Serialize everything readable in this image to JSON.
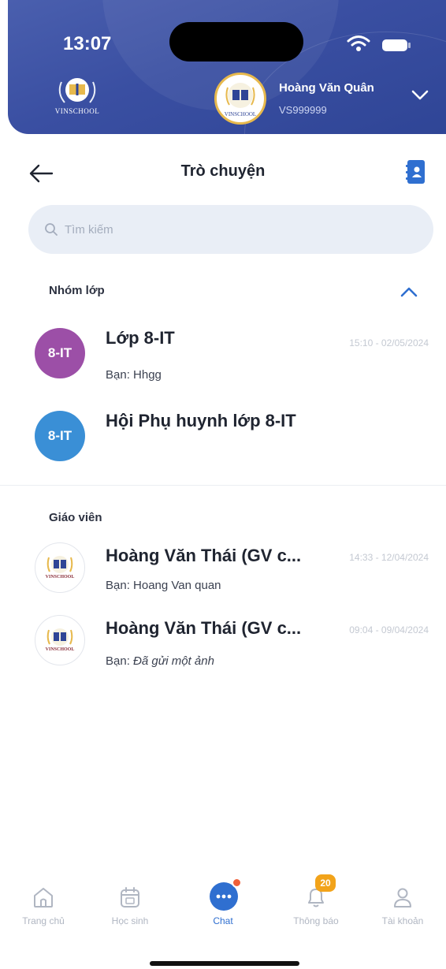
{
  "status_bar": {
    "time": "13:07"
  },
  "header": {
    "school_logo_text": "VINSCHOOL",
    "avatar_school_text": "VINSCHOOL",
    "user_name": "Hoàng Văn Quân",
    "user_code": "VS999999"
  },
  "nav": {
    "title": "Trò chuyện"
  },
  "search": {
    "placeholder": "Tìm kiếm"
  },
  "class_group": {
    "title": "Nhóm lớp",
    "items": [
      {
        "avatar": "8-IT",
        "avatar_color": "#9c4fa7",
        "name": "Lớp 8-IT",
        "time": "15:10 - 02/05/2024",
        "preview_prefix": "Bạn:",
        "preview": "Hhgg"
      },
      {
        "avatar": "8-IT",
        "avatar_color": "#3a8fd6",
        "name": "Hội Phụ huynh lớp 8-IT",
        "time": "",
        "preview_prefix": "",
        "preview": ""
      }
    ]
  },
  "teachers": {
    "title": "Giáo viên",
    "items": [
      {
        "avatar_text": "VINSCHOOL",
        "name": "Hoàng Văn Thái (GV c...",
        "time": "14:33 - 12/04/2024",
        "preview_prefix": "Bạn:",
        "preview": "Hoang Van quan"
      },
      {
        "avatar_text": "VINSCHOOL",
        "name": "Hoàng Văn Thái (GV c...",
        "time": "09:04 - 09/04/2024",
        "preview_prefix": "Bạn:",
        "preview": "Đã gửi một ảnh"
      }
    ]
  },
  "tabbar": {
    "items": [
      {
        "label": "Trang chủ",
        "icon": "home-icon"
      },
      {
        "label": "Học sinh",
        "icon": "calendar-icon"
      },
      {
        "label": "Chat",
        "icon": "chat-icon"
      },
      {
        "label": "Thông báo",
        "icon": "bell-icon",
        "badge": "20"
      },
      {
        "label": "Tài khoản",
        "icon": "user-icon"
      }
    ]
  },
  "colors": {
    "header": "#3a4fa2",
    "accent": "#2f6fd0",
    "badge": "#f2a31a",
    "chat_dot": "#f0603a"
  }
}
